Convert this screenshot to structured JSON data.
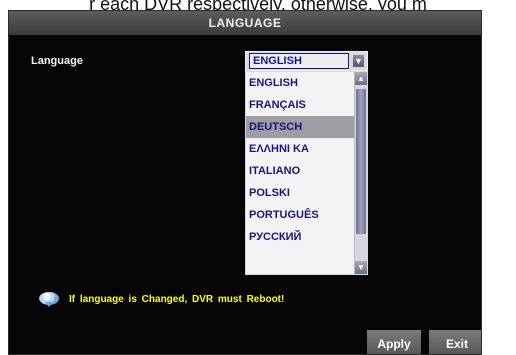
{
  "caption": "r each DVR respectively, otherwise, you m",
  "dialog": {
    "title": "LANGUAGE",
    "language_label": "Language",
    "selected_language": "ENGLISH",
    "options": [
      "ENGLISH",
      "FRANÇAIS",
      "DEUTSCH",
      "ΕΛΛΗΝΙ ΚΑ",
      "ITALIANO",
      "POLSKI",
      "PORTUGUÊS",
      "РУССКИЙ"
    ],
    "warning": "If language is Changed, DVR must Reboot!",
    "apply_label": "Apply",
    "exit_label": "Exit"
  },
  "icons": {
    "dropdown": "chevron-down-icon",
    "scroll_up": "chevron-up-icon",
    "scroll_down": "chevron-down-icon",
    "info": "info-bubble-icon"
  },
  "colors": {
    "background": "#050505",
    "accent": "#17177c",
    "warning": "#ffff00",
    "selected_row": "#9d9da3"
  }
}
